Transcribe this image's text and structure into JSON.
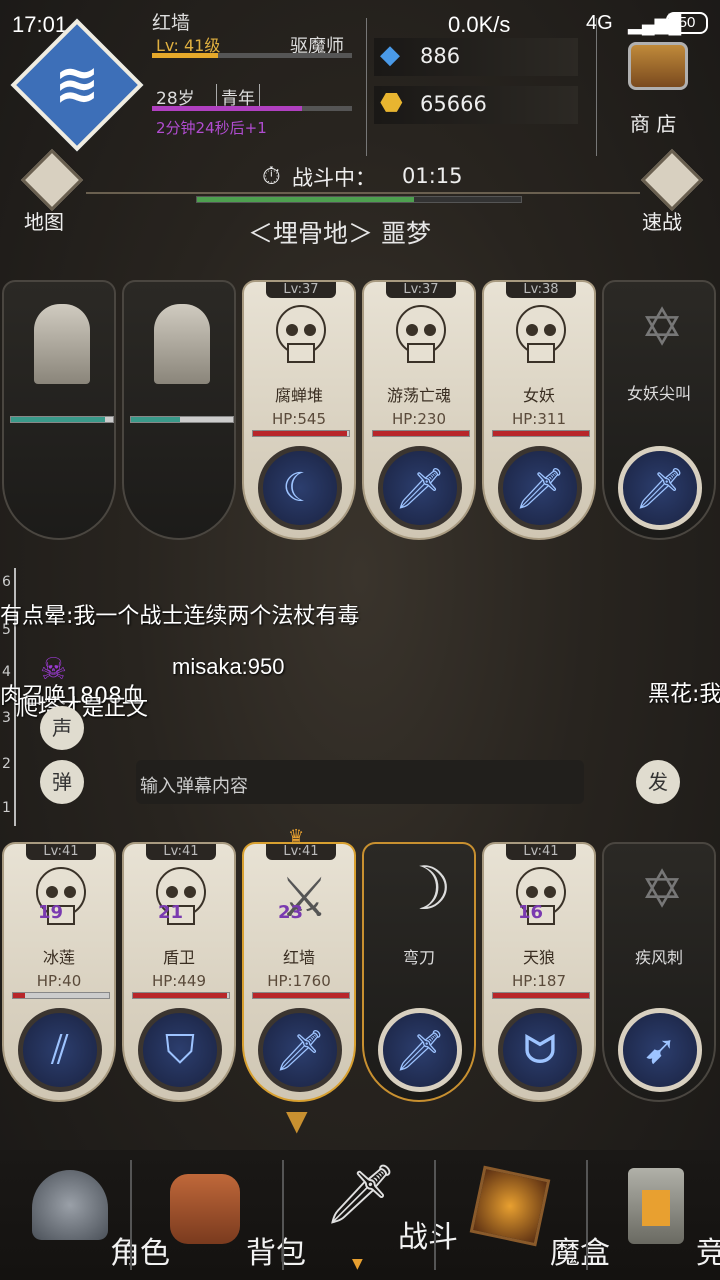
{
  "status_bar": {
    "time": "17:01",
    "net": "0.0K/s",
    "signal": "4G",
    "battery": "50"
  },
  "player": {
    "name": "红墙",
    "level": "Lv: 41级",
    "class": "驱魔师",
    "age": "28岁",
    "stage": "青年",
    "timer": "2分钟24秒后+1"
  },
  "currency": {
    "gems": "886",
    "gold": "65666"
  },
  "shop": {
    "label": "商 店"
  },
  "map": {
    "label": "地图"
  },
  "quick": {
    "label": "速战"
  },
  "battle": {
    "status": "战斗中：",
    "time": "01:15",
    "location": "＜埋骨地＞ 噩梦"
  },
  "enemies": [
    {
      "type": "tomb",
      "hp_pct": 0.92
    },
    {
      "type": "tomb",
      "hp_pct": 0.48
    },
    {
      "lv": "Lv:37",
      "name": "腐蝉堆",
      "hp": "HP:545",
      "hp_pct": 0.98,
      "skill": "slash-icon"
    },
    {
      "lv": "Lv:37",
      "name": "游荡亡魂",
      "hp": "HP:230",
      "hp_pct": 1.0,
      "skill": "sword-icon"
    },
    {
      "lv": "Lv:38",
      "name": "女妖",
      "hp": "HP:311",
      "hp_pct": 1.0,
      "skill": "sword-icon"
    },
    {
      "name": "女妖尖叫",
      "type": "spell",
      "skill": "sword-icon"
    }
  ],
  "danmu": {
    "scale": [
      "6",
      "5",
      "4",
      "3",
      "2",
      "1"
    ],
    "messages": [
      "有点晕:我一个战士连续两个法杖有毒",
      "misaka:950",
      "肉召唤1808血",
      "爬塔才是正文",
      "黑花:我"
    ],
    "voice_btn": "声",
    "popup_btn": "弹",
    "input_placeholder": "输入弹幕内容",
    "send_btn": "发"
  },
  "allies": [
    {
      "lv": "Lv:41",
      "name": "冰莲",
      "hp": "HP:40",
      "hp_pct": 0.12,
      "badge": "19",
      "skill": "claw-icon"
    },
    {
      "lv": "Lv:41",
      "name": "盾卫",
      "hp": "HP:449",
      "hp_pct": 0.98,
      "badge": "21",
      "skill": "shield-icon"
    },
    {
      "lv": "Lv:41",
      "name": "红墙",
      "hp": "HP:1760",
      "hp_pct": 1.0,
      "badge": "23",
      "skill": "sword-icon"
    },
    {
      "name": "弯刀",
      "type": "weapon",
      "skill": "sword-icon"
    },
    {
      "lv": "Lv:41",
      "name": "天狼",
      "hp": "HP:187",
      "hp_pct": 1.0,
      "badge": "16",
      "skill": "fang-icon"
    },
    {
      "name": "疾风刺",
      "type": "spell",
      "skill": "arrow-icon"
    }
  ],
  "nav": [
    {
      "label": "角色",
      "icon": "helmet-icon"
    },
    {
      "label": "背包",
      "icon": "backpack-icon"
    },
    {
      "label": "战斗",
      "icon": "sword-icon"
    },
    {
      "label": "魔盒",
      "icon": "cube-icon"
    },
    {
      "label": "竞技",
      "icon": "tower-icon"
    }
  ]
}
